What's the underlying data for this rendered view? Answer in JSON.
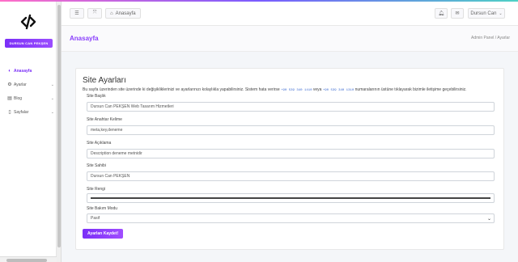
{
  "sidebar": {
    "brand_button": "DURSUN CAN PEKŞEN",
    "items": [
      {
        "label": "Anasayfa",
        "icon": "dashboard-icon",
        "active": true
      },
      {
        "label": "Ayarlar",
        "icon": "gears-icon"
      },
      {
        "label": "Blog",
        "icon": "blog-icon"
      },
      {
        "label": "Sayfalar",
        "icon": "pages-icon"
      }
    ]
  },
  "topbar": {
    "home_label": "Anasayfa",
    "user_label": "Dursun Can"
  },
  "header": {
    "title": "Anasayfa",
    "breadcrumb": "Admin Panel / Ayarlar"
  },
  "settings": {
    "title": "Site Ayarları",
    "description_pre": "Bu sayfa üzerinden site üzerinde ki değişikliklerinizi ve ayarlarınızı kolaylıkla yapabilirsiniz. Sistem hata verirse",
    "phone1": "+90 539 340 1410",
    "description_mid": "veya",
    "phone2": "+90 539 340 1310",
    "description_post": "numaralarının üstüne tıklayarak bizimle iletişime geçebilirsiniz.",
    "fields": {
      "baslik_label": "Site Başlık",
      "baslik_value": "Dursun Can PEKŞEN Web Tasarım Hizmetleri",
      "anahtar_label": "Site Anahtar Kelime",
      "anahtar_value": "meta,key,deneme",
      "aciklama_label": "Site Açıklama",
      "aciklama_value": "Description deneme metnidir",
      "sahibi_label": "Site Sahibi",
      "sahibi_value": "Dursun Can PEKŞEN",
      "renk_label": "Site Rengi",
      "renk_value": "#444444",
      "bakim_label": "Site Bakım Modu",
      "bakim_value": "Pasif"
    },
    "save_label": "Ayarları Kaydet!"
  },
  "colors": {
    "accent": "#7b2ff7",
    "title_purple": "#8a3ffc"
  }
}
